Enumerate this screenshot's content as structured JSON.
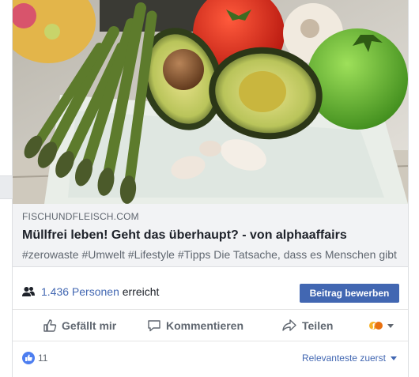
{
  "link_preview": {
    "domain": "FISCHUNDFLEISCH.COM",
    "title": "Müllfrei leben! Geht das überhaupt? - von alphaaffairs",
    "description": "#zerowaste #Umwelt #Lifestyle #Tipps Die Tatsache, dass es Menschen gibt"
  },
  "reach": {
    "count": "1.436 Personen",
    "suffix": "erreicht",
    "boost_label": "Beitrag bewerben"
  },
  "actions": {
    "like": "Gefällt mir",
    "comment": "Kommentieren",
    "share": "Teilen"
  },
  "footer": {
    "like_count": "11",
    "sort_label": "Relevanteste zuerst"
  },
  "colors": {
    "accent": "#4267b2",
    "like_badge": "#4d7ef0",
    "preview_bg": "#f2f3f5"
  },
  "icons": [
    "people-icon",
    "thumbs-up-icon",
    "comment-icon",
    "share-icon",
    "reaction-picker-icon",
    "chevron-down-icon"
  ]
}
